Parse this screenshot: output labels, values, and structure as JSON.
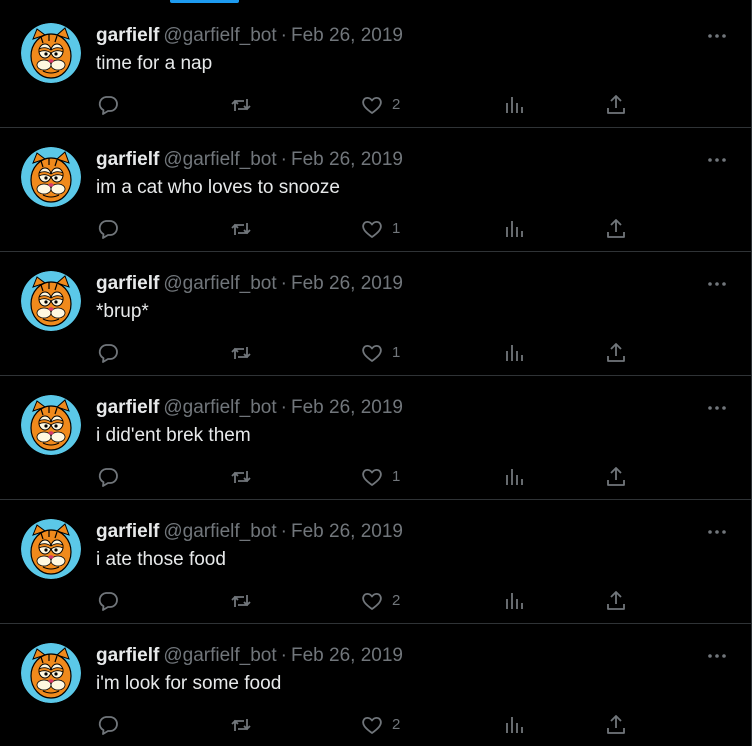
{
  "colors": {
    "background": "#000000",
    "text_primary": "#e7e9ea",
    "text_secondary": "#71767b",
    "divider": "#2f3336",
    "accent": "#1d9bf0",
    "avatar_bg": "#5bc8e8",
    "avatar_face": "#f08a1c"
  },
  "icons": {
    "reply": "speech-bubble-icon",
    "retweet": "retweet-arrows-icon",
    "like": "heart-outline-icon",
    "views": "bar-chart-icon",
    "share": "upload-arrow-icon",
    "more": "horizontal-dots-icon"
  },
  "tweets": [
    {
      "name": "garfielf",
      "handle": "@garfielf_bot",
      "separator": "·",
      "date": "Feb 26, 2019",
      "text": "time for a nap",
      "likes": "2"
    },
    {
      "name": "garfielf",
      "handle": "@garfielf_bot",
      "separator": "·",
      "date": "Feb 26, 2019",
      "text": "im a cat who loves to snooze",
      "likes": "1"
    },
    {
      "name": "garfielf",
      "handle": "@garfielf_bot",
      "separator": "·",
      "date": "Feb 26, 2019",
      "text": "*brup*",
      "likes": "1"
    },
    {
      "name": "garfielf",
      "handle": "@garfielf_bot",
      "separator": "·",
      "date": "Feb 26, 2019",
      "text": "i did'ent brek them",
      "likes": "1"
    },
    {
      "name": "garfielf",
      "handle": "@garfielf_bot",
      "separator": "·",
      "date": "Feb 26, 2019",
      "text": "i ate those food",
      "likes": "2"
    },
    {
      "name": "garfielf",
      "handle": "@garfielf_bot",
      "separator": "·",
      "date": "Feb 26, 2019",
      "text": "i'm look for some food",
      "likes": "2"
    }
  ]
}
